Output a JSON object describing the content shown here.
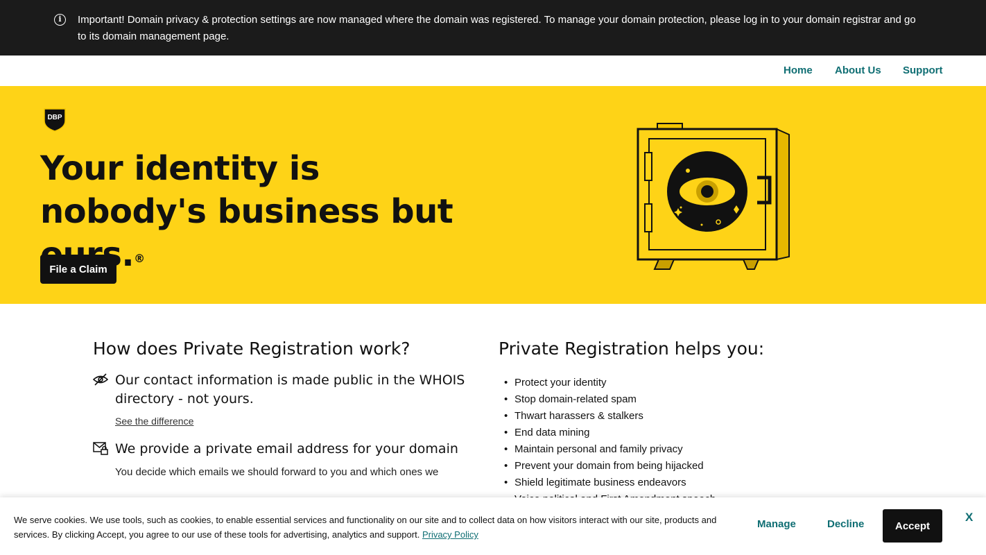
{
  "notice": {
    "text": "Important! Domain privacy & protection settings are now managed where the domain was registered. To manage your domain protection, please log in to your domain registrar and go to its domain management page."
  },
  "nav": {
    "home": "Home",
    "about": "About Us",
    "support": "Support"
  },
  "hero": {
    "logo_text": "DBP",
    "title": "Your identity is nobody's business but ours.",
    "registered_mark": "®",
    "cta": "File a Claim"
  },
  "how": {
    "title": "How does Private Registration work?",
    "features": [
      {
        "icon": "eye-slash-icon",
        "title": "Our contact information is made public in the WHOIS directory - not yours.",
        "link": "See the difference"
      },
      {
        "icon": "mail-lock-icon",
        "title": "We provide a private email address for your domain",
        "text": "You decide which emails we should forward to you and which ones we"
      }
    ]
  },
  "helps": {
    "title": "Private Registration helps you:",
    "items": [
      "Protect your identity",
      "Stop domain-related spam",
      "Thwart harassers & stalkers",
      "End data mining",
      "Maintain personal and family privacy",
      "Prevent your domain from being hijacked",
      "Shield legitimate business endeavors",
      "Voice political and First Amendment speech"
    ]
  },
  "cookies": {
    "text": "We serve cookies. We use tools, such as cookies, to enable essential services and functionality on our site and to collect data on how visitors interact with our site, products and services. By clicking Accept, you agree to our use of these tools for advertising, analytics and support.",
    "policy_link": "Privacy Policy",
    "manage": "Manage",
    "decline": "Decline",
    "accept": "Accept",
    "close": "X"
  },
  "colors": {
    "accent": "#0f6e73",
    "hero_bg": "#fed317",
    "notice_bg": "#1b1b1b"
  }
}
